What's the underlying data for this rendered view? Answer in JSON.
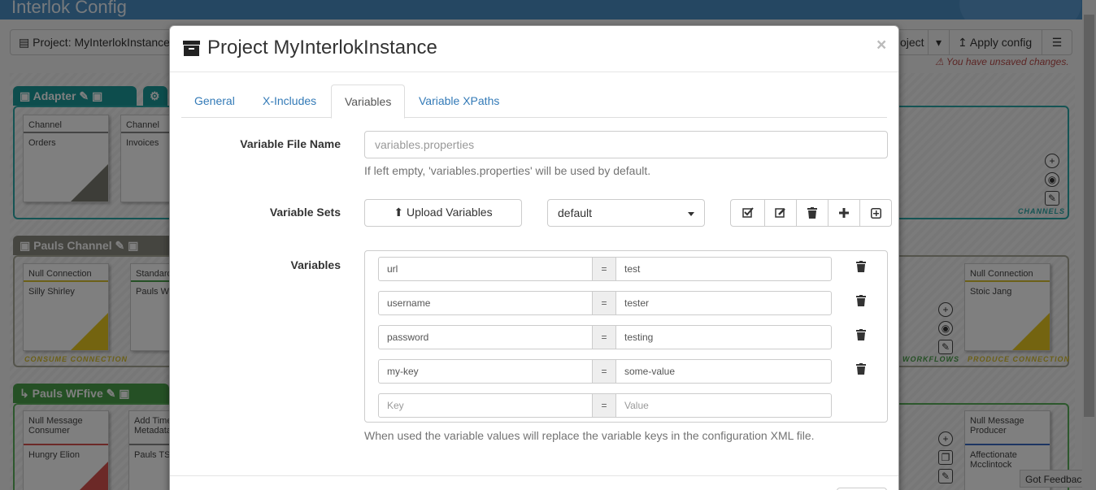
{
  "app": {
    "title": "Interlok Config",
    "project_button": "Project: MyInterlokInstance",
    "project_menu": "oject",
    "apply_button": "Apply config",
    "unsaved": "You have unsaved changes.",
    "feedback": "Got Feedback?"
  },
  "background": {
    "adapter_tab": "Adapter",
    "channels": [
      {
        "title": "Channel",
        "name": "Orders"
      },
      {
        "title": "Channel",
        "name": "Invoices"
      }
    ],
    "channels_label": "CHANNELS",
    "pauls_channel": "Pauls Channel",
    "consume_card": {
      "title": "Null Connection",
      "name": "Silly Shirley"
    },
    "consume_label": "CONSUME CONNECTION",
    "standard_card": {
      "title": "Standard",
      "name": "Pauls WF"
    },
    "produce_card": {
      "title": "Null Connection",
      "name": "Stoic Jang"
    },
    "produce_label": "PRODUCE CONNECTION",
    "workflows_label": "WORKFLOWS",
    "pauls_wf": "Pauls WFfive",
    "consumer_card": {
      "title": "Null Message Consumer",
      "name": "Hungry Elion"
    },
    "metadata_card": {
      "title": "Add Time Metadata",
      "name": "Pauls TS Paultime"
    },
    "producer_card": {
      "title": "Null Message Producer",
      "name": "Affectionate Mcclintock"
    }
  },
  "modal": {
    "title": "Project MyInterlokInstance",
    "close": "×",
    "tabs": [
      {
        "label": "General"
      },
      {
        "label": "X-Includes"
      },
      {
        "label": "Variables"
      },
      {
        "label": "Variable XPaths"
      }
    ],
    "file_name_label": "Variable File Name",
    "file_name_placeholder": "variables.properties",
    "file_name_help": "If left empty, 'variables.properties' will be used by default.",
    "sets_label": "Variable Sets",
    "upload_label": "Upload Variables",
    "set_selected": "default",
    "variables_label": "Variables",
    "equals": "=",
    "variables": [
      {
        "key": "url",
        "value": "test"
      },
      {
        "key": "username",
        "value": "tester"
      },
      {
        "key": "password",
        "value": "testing"
      },
      {
        "key": "my-key",
        "value": "some-value"
      }
    ],
    "new_key_placeholder": "Key",
    "new_value_placeholder": "Value",
    "variables_help": "When used the variable values will replace the variable keys in the configuration XML file."
  }
}
